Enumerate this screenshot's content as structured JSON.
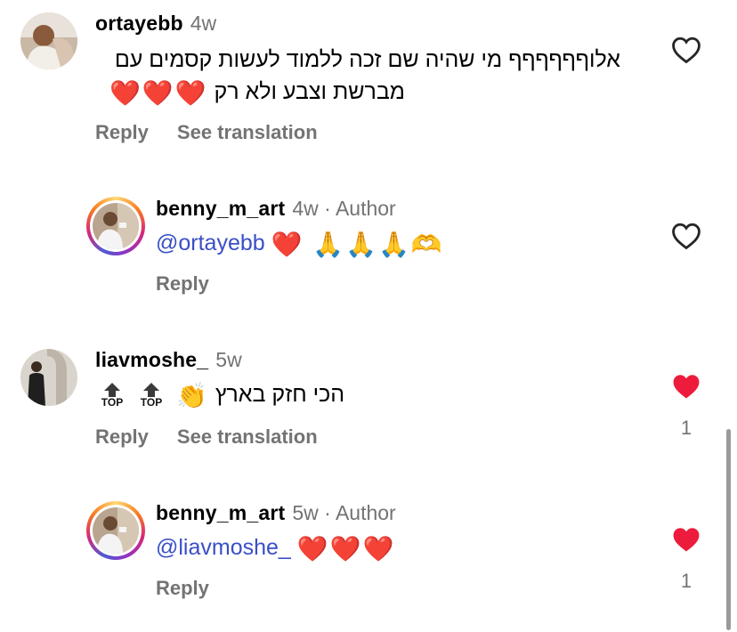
{
  "colors": {
    "mention": "#3a4fc7",
    "secondary_text": "#737373",
    "liked_heart": "#ed1c3c",
    "story_ring": [
      "#feda75",
      "#fa7e1e",
      "#d62976",
      "#962fbf",
      "#4f5bd5"
    ]
  },
  "comments": [
    {
      "username": "ortayebb",
      "time": "4w",
      "text_line1": "אלוףףףףףף מי שהיה שם זכה ללמוד לעשות קסמים עם",
      "text_line2": "מברשת וצבע ולא רק",
      "text_emoji": "❤️❤️❤️",
      "reply_label": "Reply",
      "translate_label": "See translation",
      "liked": false,
      "avatar_icon": "profile-photo"
    },
    {
      "username": "benny_m_art",
      "time": "4w",
      "author_tag": "· Author",
      "mention": "@ortayebb",
      "text_emoji": "❤️ 🙏🙏🙏🫶",
      "reply_label": "Reply",
      "liked": false,
      "avatar_icon": "profile-photo-story-ring"
    },
    {
      "username": "liavmoshe_",
      "time": "5w",
      "top_label": "TOP",
      "text": "הכי חזק בארץ",
      "text_emoji": "👏",
      "reply_label": "Reply",
      "translate_label": "See translation",
      "liked": true,
      "like_count": "1",
      "avatar_icon": "profile-photo"
    },
    {
      "username": "benny_m_art",
      "time": "5w",
      "author_tag": "· Author",
      "mention": "@liavmoshe_",
      "text_emoji": "❤️❤️❤️",
      "reply_label": "Reply",
      "liked": true,
      "like_count": "1",
      "avatar_icon": "profile-photo-story-ring"
    }
  ]
}
